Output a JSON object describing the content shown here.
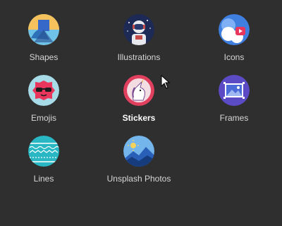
{
  "categories": [
    {
      "label": "Shapes",
      "icon": "shapes-icon"
    },
    {
      "label": "Illustrations",
      "icon": "astronaut-illustration-icon"
    },
    {
      "label": "Icons",
      "icon": "cloud-play-icon"
    },
    {
      "label": "Emojis",
      "icon": "sunglasses-emoji-icon"
    },
    {
      "label": "Stickers",
      "icon": "unicorn-sticker-icon"
    },
    {
      "label": "Frames",
      "icon": "photo-frame-icon"
    },
    {
      "label": "Lines",
      "icon": "wavy-lines-icon"
    },
    {
      "label": "Unsplash Photos",
      "icon": "mountain-sun-photo-icon"
    }
  ],
  "colors": {
    "background": "#2f2f30",
    "label": "#d6d6d6",
    "active_label": "#ffffff"
  }
}
